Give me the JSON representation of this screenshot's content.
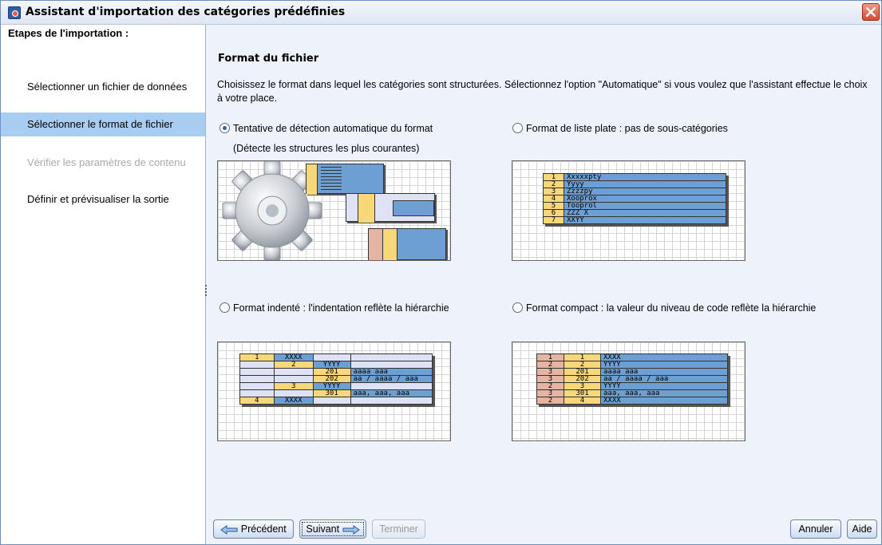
{
  "window": {
    "title": "Assistant d'importation des catégories prédéfinies"
  },
  "sidebar": {
    "title": "Etapes de l'importation :",
    "steps": [
      {
        "label": "Sélectionner un fichier de données",
        "state": "normal"
      },
      {
        "label": "Sélectionner le format de fichier",
        "state": "active"
      },
      {
        "label": "Vérifier les paramètres de contenu",
        "state": "disabled"
      },
      {
        "label": "Définir et prévisualiser la sortie",
        "state": "normal"
      }
    ]
  },
  "main": {
    "title": "Format du fichier",
    "description": "Choisissez le format dans lequel les catégories sont structurées. Sélectionnez l'option \"Automatique\" si vous voulez que l'assistant effectue le choix à votre place.",
    "options": {
      "auto": {
        "label": "Tentative de détection automatique du format",
        "sub": "(Détecte les structures les plus courantes)",
        "checked": true
      },
      "flat": {
        "label": "Format de liste plate : pas de sous-catégories",
        "checked": false
      },
      "indented": {
        "label": "Format indenté : l'indentation reflète la hiérarchie",
        "checked": false
      },
      "compact": {
        "label": "Format compact : la valeur du niveau de code reflète la hiérarchie",
        "checked": false
      }
    },
    "previews": {
      "flat": {
        "rows": [
          [
            "1",
            "Xxxxxpty"
          ],
          [
            "2",
            "Yyyy"
          ],
          [
            "3",
            "Zzzzpy"
          ],
          [
            "4",
            "Xooprox"
          ],
          [
            "5",
            "Tooprol"
          ],
          [
            "6",
            "ZZZ X"
          ],
          [
            "7",
            "XXYY"
          ]
        ]
      },
      "indented": {
        "rows": [
          [
            "1",
            "XXXX",
            "",
            "",
            ""
          ],
          [
            "",
            "2",
            "YYYY",
            "",
            ""
          ],
          [
            "",
            "",
            "201",
            "aaaa aaa",
            ""
          ],
          [
            "",
            "",
            "202",
            "aa / aaaa / aaa",
            ""
          ],
          [
            "",
            "3",
            "YYYY",
            "",
            ""
          ],
          [
            "",
            "",
            "301",
            "aaa, aaa, aaa",
            ""
          ],
          [
            "4",
            "XXXX",
            "",
            "",
            ""
          ]
        ]
      },
      "compact": {
        "rows": [
          [
            "1",
            "1",
            "XXXX"
          ],
          [
            "2",
            "2",
            "YYYY"
          ],
          [
            "3",
            "201",
            "aaaa aaa"
          ],
          [
            "3",
            "202",
            "aa / aaaa / aaa"
          ],
          [
            "2",
            "3",
            "YYYY"
          ],
          [
            "3",
            "301",
            "aaa, aaa, aaa"
          ],
          [
            "2",
            "4",
            "XXXX"
          ]
        ]
      }
    }
  },
  "footer": {
    "previous": "Précédent",
    "next": "Suivant",
    "finish": "Terminer",
    "cancel": "Annuler",
    "help": "Aide"
  },
  "colors": {
    "accent_selection": "#a9cdf0",
    "table_yellow": "#f6d77a",
    "table_blue": "#6e9fd3",
    "table_lavender": "#dfe1f5",
    "table_salmon": "#e4b5a3"
  }
}
